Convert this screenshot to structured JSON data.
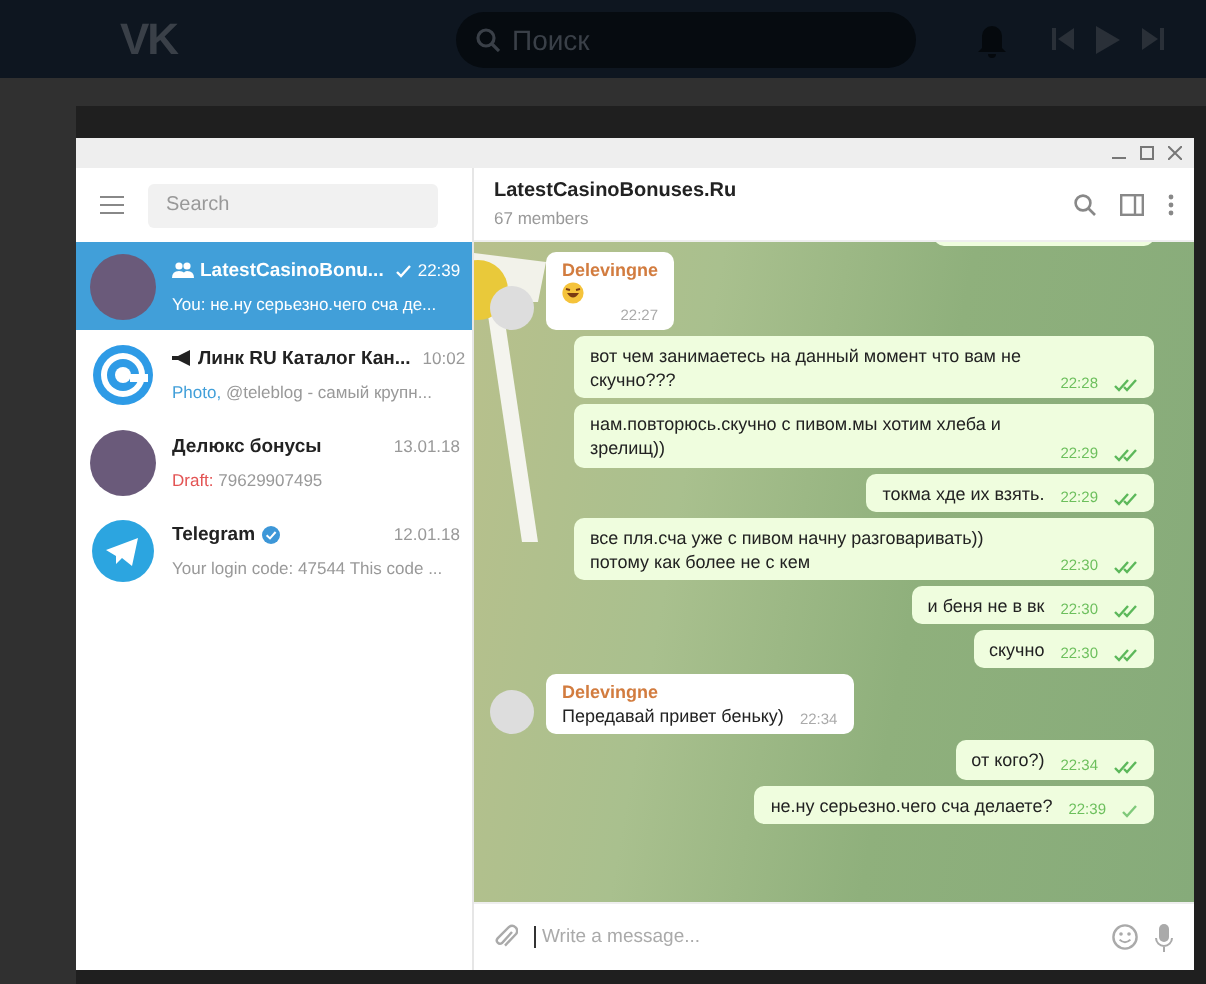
{
  "vk_bar": {
    "logo": "VK",
    "search_placeholder": "Поиск"
  },
  "sidebar": {
    "search_placeholder": "Search",
    "chats": [
      {
        "name": "LatestCasinoBonu...",
        "kind": "group",
        "verified": false,
        "time": "22:39",
        "sent": true,
        "preview_label": {
          "text": "You:",
          "kind": "self"
        },
        "preview": "не.ну серьезно.чего сча де...",
        "avatar": {
          "kind": "photo"
        },
        "selected": true
      },
      {
        "name": "Линк RU Каталог Кан...",
        "kind": "channel",
        "verified": false,
        "time": "10:02",
        "sent": false,
        "preview_label": {
          "text": "Photo,",
          "kind": "media"
        },
        "preview": "@teleblog - самый крупн...",
        "avatar": {
          "kind": "at"
        },
        "selected": false
      },
      {
        "name": "Делюкс бонусы",
        "kind": "user",
        "verified": false,
        "time": "13.01.18",
        "sent": false,
        "preview_label": {
          "text": "Draft:",
          "kind": "draft"
        },
        "preview": "79629907495",
        "avatar": {
          "kind": "photo"
        },
        "selected": false
      },
      {
        "name": "Telegram",
        "kind": "user",
        "verified": true,
        "time": "12.01.18",
        "sent": false,
        "preview": "Your login code: 47544  This code ...",
        "avatar": {
          "kind": "telegram"
        },
        "selected": false
      }
    ]
  },
  "chat": {
    "title": "LatestCasinoBonuses.Ru",
    "subtitle": "67 members",
    "input_placeholder": "Write a message...",
    "messages": [
      {
        "kind": "out"
      },
      {
        "kind": "in",
        "sender": "Delevingne",
        "emoji": true,
        "time": "22:27"
      },
      {
        "kind": "out",
        "text": "вот чем занимаетесь на данный момент что вам не скучно???",
        "time": "22:28",
        "read": true
      },
      {
        "kind": "out",
        "text": "нам.повторюсь.скучно с пивом.мы хотим хлеба и зрелищ))",
        "time": "22:29",
        "read": true
      },
      {
        "kind": "out",
        "text": "токма хде их взять.",
        "time": "22:29",
        "read": true
      },
      {
        "kind": "out",
        "text": "все пля.сча уже с пивом начну разговаривать)) потому как более не с кем",
        "time": "22:30",
        "read": true
      },
      {
        "kind": "out",
        "text": "и беня не в вк",
        "time": "22:30",
        "read": true
      },
      {
        "kind": "out",
        "text": "скучно",
        "time": "22:30",
        "read": true
      },
      {
        "kind": "in",
        "sender": "Delevingne",
        "emoji": false,
        "text": "Передавай привет беньку)",
        "time": "22:34"
      },
      {
        "kind": "out",
        "text": "от кого?)",
        "time": "22:34",
        "read": true
      },
      {
        "kind": "out",
        "text": "не.ну серьезно.чего сча делаете?",
        "time": "22:39",
        "read": false
      }
    ]
  }
}
